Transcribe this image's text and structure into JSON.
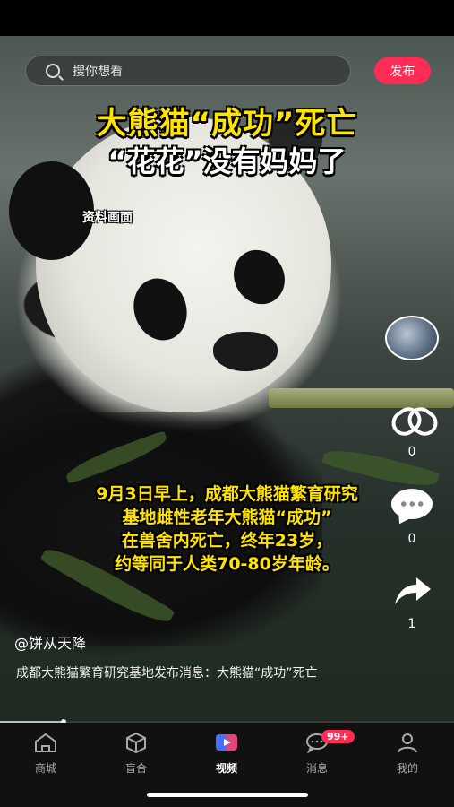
{
  "search": {
    "placeholder": "搜你想看"
  },
  "header": {
    "publish_label": "发布"
  },
  "video": {
    "headline_line1": "大熊猫“成功”死亡",
    "headline_line2": "“花花”没有妈妈了",
    "archive_label": "资料画面",
    "caption_lines": [
      "9月3日早上，成都大熊猫繁育研究",
      "基地雌性老年大熊猫“成功”",
      "在兽舍内死亡，终年23岁，",
      "约等同于人类70-80岁年龄。"
    ],
    "progress": 0.14
  },
  "actions": {
    "like_count": "0",
    "comment_count": "0",
    "share_count": "1"
  },
  "post": {
    "user_handle": "@饼从天降",
    "description": "成都大熊猫繁育研究基地发布消息：大熊猫“成功”死亡"
  },
  "tabs": [
    {
      "label": "商城",
      "icon": "store-icon"
    },
    {
      "label": "盲合",
      "icon": "box-icon"
    },
    {
      "label": "视频",
      "icon": "video-icon",
      "active": true
    },
    {
      "label": "消息",
      "icon": "message-icon",
      "badge": "99+"
    },
    {
      "label": "我的",
      "icon": "profile-icon"
    }
  ],
  "colors": {
    "accent": "#ff2d55",
    "headline": "#ffe400",
    "tabbar_bg": "#111111"
  }
}
